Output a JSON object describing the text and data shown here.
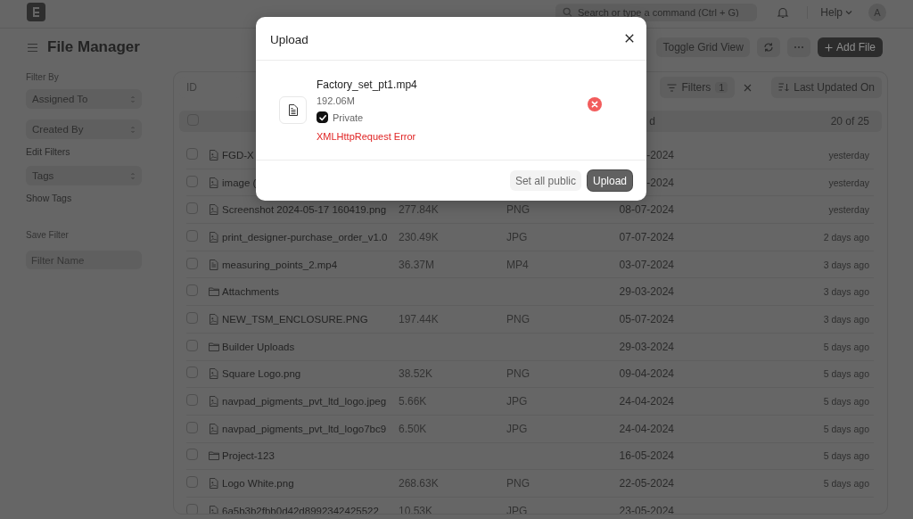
{
  "navbar": {
    "search": {
      "placeholder": "Search or type a command (Ctrl + G)"
    },
    "help": "Help",
    "avatar": "A"
  },
  "page": {
    "title": "File Manager",
    "toggle_view": "Toggle Grid View",
    "add_file": "Add File"
  },
  "sidebar": {
    "filter_by": "Filter By",
    "selects": [
      "Assigned To",
      "Created By"
    ],
    "edit_filters": "Edit Filters",
    "tags_select": "Tags",
    "show_tags": "Show Tags",
    "save_filter": "Save Filter",
    "filter_name": {
      "placeholder": "Filter Name"
    }
  },
  "list": {
    "id_filter": {
      "placeholder": "ID"
    },
    "filters": {
      "label": "Filters",
      "count": "1"
    },
    "sort": "Last Updated On",
    "header": {
      "column_4": "d",
      "count": "20 of 25",
      "checked": false
    },
    "rows": [
      {
        "kind": "image",
        "checked": false,
        "name": "FGD-X",
        "date": "-2024",
        "modified": "yesterday"
      },
      {
        "kind": "image",
        "checked": false,
        "name": "image (",
        "date": "-2024",
        "modified": "yesterday"
      },
      {
        "kind": "image",
        "checked": false,
        "name": "Screenshot 2024-05-17 160419.png",
        "size": "277.84K",
        "format": "PNG",
        "date": "08-07-2024",
        "modified": "yesterday"
      },
      {
        "kind": "image",
        "checked": false,
        "name": "print_designer-purchase_order_v1.0",
        "size": "230.49K",
        "format": "JPG",
        "date": "07-07-2024",
        "modified": "2 days ago"
      },
      {
        "kind": "file",
        "checked": false,
        "name": "measuring_points_2.mp4",
        "size": "36.37M",
        "format": "MP4",
        "date": "03-07-2024",
        "modified": "3 days ago"
      },
      {
        "kind": "folder",
        "checked": false,
        "name": "Attachments",
        "date": "29-03-2024",
        "modified": "3 days ago"
      },
      {
        "kind": "image",
        "checked": false,
        "name": "NEW_TSM_ENCLOSURE.PNG",
        "size": "197.44K",
        "format": "PNG",
        "date": "05-07-2024",
        "modified": "3 days ago"
      },
      {
        "kind": "folder",
        "checked": false,
        "name": "Builder Uploads",
        "date": "29-03-2024",
        "modified": "5 days ago"
      },
      {
        "kind": "image",
        "checked": false,
        "name": "Square Logo.png",
        "size": "38.52K",
        "format": "PNG",
        "date": "09-04-2024",
        "modified": "5 days ago"
      },
      {
        "kind": "image",
        "checked": false,
        "name": "navpad_pigments_pvt_ltd_logo.jpeg",
        "size": "5.66K",
        "format": "JPG",
        "date": "24-04-2024",
        "modified": "5 days ago"
      },
      {
        "kind": "image",
        "checked": false,
        "name": "navpad_pigments_pvt_ltd_logo7bc9",
        "size": "6.50K",
        "format": "JPG",
        "date": "24-04-2024",
        "modified": "5 days ago"
      },
      {
        "kind": "folder",
        "checked": false,
        "name": "Project-123",
        "date": "16-05-2024",
        "modified": "5 days ago"
      },
      {
        "kind": "image",
        "checked": false,
        "name": "Logo White.png",
        "size": "268.63K",
        "format": "PNG",
        "date": "22-05-2024",
        "modified": "5 days ago"
      },
      {
        "kind": "image",
        "checked": false,
        "name": "6a5b3b2fbb0d42d8992342425522",
        "size": "10.53K",
        "format": "JPG",
        "date": "23-05-2024"
      }
    ]
  },
  "dialog": {
    "title": "Upload",
    "files": [
      {
        "name": "Factory_set_pt1.mp4",
        "size": "192.06M",
        "private": true,
        "private_label": "Private",
        "error": "XMLHttpRequest Error"
      }
    ],
    "set_all_public": "Set all public",
    "upload": "Upload"
  }
}
